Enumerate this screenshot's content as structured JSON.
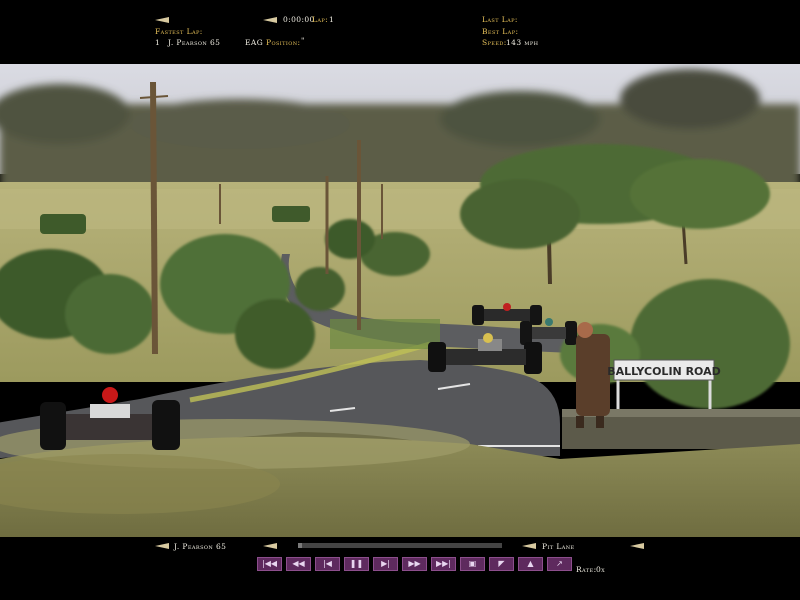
{
  "hud": {
    "time": "0:00:00",
    "lap_label": "Lap:",
    "lap_value": "1",
    "fastest_lap_label": "Fastest Lap:",
    "fastest_lap_position": "1",
    "fastest_lap_driver": "J. Pearson 65",
    "team": "EAG",
    "position_label": "Position:",
    "position_value": "\"",
    "last_lap_label": "Last Lap:",
    "best_lap_label": "Best Lap:",
    "speed_label": "Speed:",
    "speed_value": "143 mph"
  },
  "scene": {
    "sign_text": "BALLYCOLIN ROAD"
  },
  "replay": {
    "driver": "J. Pearson 65",
    "camera": "Pit Lane",
    "rate_label": "Rate:",
    "rate_value": "0x",
    "progress": 0.02,
    "buttons": [
      {
        "name": "rewind-start-button",
        "icon": "|◀◀"
      },
      {
        "name": "fast-rewind-button",
        "icon": "◀◀"
      },
      {
        "name": "step-back-button",
        "icon": "|◀"
      },
      {
        "name": "pause-button",
        "icon": "❚❚"
      },
      {
        "name": "play-button",
        "icon": "▶|"
      },
      {
        "name": "fast-forward-button",
        "icon": "▶▶"
      },
      {
        "name": "forward-end-button",
        "icon": "▶▶|"
      },
      {
        "name": "camera-button",
        "icon": "▣"
      },
      {
        "name": "mark-button",
        "icon": "◤"
      },
      {
        "name": "record-button",
        "icon": "▲"
      },
      {
        "name": "exit-button",
        "icon": "↗"
      }
    ]
  },
  "colors": {
    "hud_text": "#e8c25a",
    "button_bg": "#5e2a5e"
  }
}
